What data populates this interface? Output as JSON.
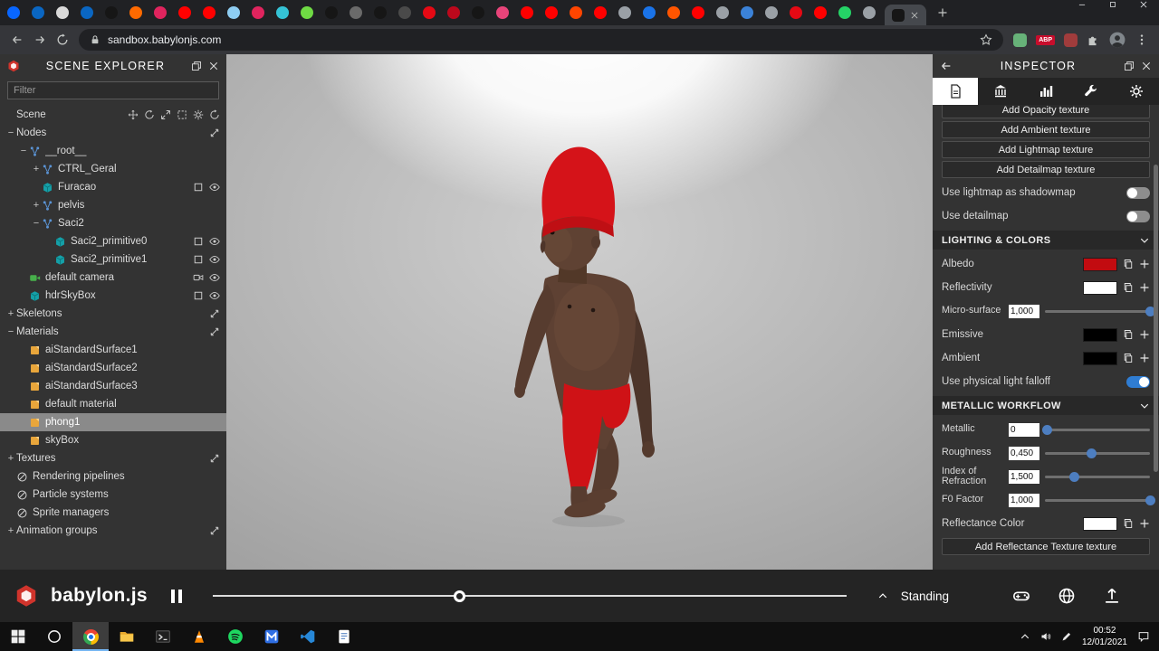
{
  "browser": {
    "tab_favicons": [
      "#0866ff",
      "#0a66c2",
      "#d9d9d9",
      "#0a66c2",
      "#161616",
      "#ff6a00",
      "#e0245e",
      "#ff0000",
      "#ff0000",
      "#8ecdf2",
      "#e0245e",
      "#35c3d6",
      "#6fda44",
      "#161616",
      "#6a6a6a",
      "#161616",
      "#4a4a4a",
      "#e50914",
      "#bd081c",
      "#161616",
      "#e8447a",
      "#ff0000",
      "#ff0000",
      "#ff4500",
      "#ff0000",
      "#9aa0a6",
      "#1a73e8",
      "#ff5500",
      "#ff0000",
      "#9aa0a6",
      "#3b82d8",
      "#9aa0a6",
      "#e50914",
      "#ff0000",
      "#25d366",
      "#9aa0a6"
    ],
    "active_tab_color": "#161616",
    "url": "sandbox.babylonjs.com",
    "extensions": [
      {
        "name": "adguard-extension-icon",
        "color": "#67b279"
      },
      {
        "name": "adblock-plus-extension-icon",
        "color": "#c70d2c",
        "label": "ABP"
      },
      {
        "name": "onetab-extension-icon",
        "color": "#a03c3c"
      },
      {
        "name": "extensions-puzzle-icon",
        "color": "#c4c7c5"
      }
    ]
  },
  "explorer": {
    "title": "SCENE EXPLORER",
    "filter_placeholder": "Filter",
    "items": [
      {
        "label": "Scene",
        "level": 0,
        "right": [
          "move-gizmo-icon",
          "rotate-gizmo-icon",
          "scale-gizmo-icon",
          "bbox-gizmo-icon",
          "gear-icon",
          "refresh-icon"
        ]
      },
      {
        "label": "Nodes",
        "level": 0,
        "exp": "−",
        "right": [
          "expand-all-icon"
        ]
      },
      {
        "label": "__root__",
        "level": 1,
        "exp": "−",
        "icon": "transform-node-icon"
      },
      {
        "label": "CTRL_Geral",
        "level": 2,
        "exp": "+",
        "icon": "transform-node-icon"
      },
      {
        "label": "Furacao",
        "level": 2,
        "icon": "mesh-icon",
        "right": [
          "checkbox-icon",
          "eye-icon"
        ]
      },
      {
        "label": "pelvis",
        "level": 2,
        "exp": "+",
        "icon": "transform-node-icon"
      },
      {
        "label": "Saci2",
        "level": 2,
        "exp": "−",
        "icon": "transform-node-icon"
      },
      {
        "label": "Saci2_primitive0",
        "level": 3,
        "icon": "mesh-icon",
        "right": [
          "checkbox-icon",
          "eye-icon"
        ]
      },
      {
        "label": "Saci2_primitive1",
        "level": 3,
        "icon": "mesh-icon",
        "right": [
          "checkbox-icon",
          "eye-icon"
        ]
      },
      {
        "label": "default camera",
        "level": 1,
        "icon": "camera-icon",
        "right": [
          "videocam-icon",
          "eye-icon"
        ]
      },
      {
        "label": "hdrSkyBox",
        "level": 1,
        "icon": "mesh-icon",
        "right": [
          "checkbox-icon",
          "eye-icon"
        ]
      },
      {
        "label": "Skeletons",
        "level": 0,
        "exp": "+",
        "right": [
          "expand-all-icon"
        ]
      },
      {
        "label": "Materials",
        "level": 0,
        "exp": "−",
        "right": [
          "expand-all-icon"
        ]
      },
      {
        "label": "aiStandardSurface1",
        "level": 1,
        "icon": "material-icon"
      },
      {
        "label": "aiStandardSurface2",
        "level": 1,
        "icon": "material-icon"
      },
      {
        "label": "aiStandardSurface3",
        "level": 1,
        "icon": "material-icon"
      },
      {
        "label": "default material",
        "level": 1,
        "icon": "material-icon"
      },
      {
        "label": "phong1",
        "level": 1,
        "icon": "material-icon",
        "selected": true
      },
      {
        "label": "skyBox",
        "level": 1,
        "icon": "material-icon"
      },
      {
        "label": "Textures",
        "level": 0,
        "exp": "+",
        "right": [
          "expand-all-icon"
        ]
      },
      {
        "label": "Rendering pipelines",
        "level": 0,
        "icon": "circle-slash-icon"
      },
      {
        "label": "Particle systems",
        "level": 0,
        "icon": "circle-slash-icon"
      },
      {
        "label": "Sprite managers",
        "level": 0,
        "icon": "circle-slash-icon"
      },
      {
        "label": "Animation groups",
        "level": 0,
        "exp": "+",
        "right": [
          "expand-all-icon"
        ]
      }
    ]
  },
  "inspector": {
    "title": "INSPECTOR",
    "tabs": [
      {
        "icon": "file-tab-icon",
        "active": true
      },
      {
        "icon": "debug-tab-icon"
      },
      {
        "icon": "stats-tab-icon"
      },
      {
        "icon": "tools-tab-icon"
      },
      {
        "icon": "settings-tab-icon"
      }
    ],
    "content": [
      {
        "type": "button",
        "label": "Add Opacity texture",
        "clipped": true
      },
      {
        "type": "button",
        "label": "Add Ambient texture"
      },
      {
        "type": "button",
        "label": "Add Lightmap texture"
      },
      {
        "type": "button",
        "label": "Add Detailmap texture"
      },
      {
        "type": "toggle",
        "label": "Use lightmap as shadowmap",
        "on": false
      },
      {
        "type": "toggle",
        "label": "Use detailmap",
        "on": false
      },
      {
        "type": "section",
        "label": "LIGHTING & COLORS"
      },
      {
        "type": "color",
        "label": "Albedo",
        "color": "#c20b10"
      },
      {
        "type": "color",
        "label": "Reflectivity",
        "color": "#ffffff"
      },
      {
        "type": "slider",
        "label": "Micro-surface",
        "value": "1,000",
        "pct": 100
      },
      {
        "type": "color",
        "label": "Emissive",
        "color": "#000000"
      },
      {
        "type": "color",
        "label": "Ambient",
        "color": "#000000"
      },
      {
        "type": "toggle",
        "label": "Use physical light falloff",
        "on": true
      },
      {
        "type": "section",
        "label": "METALLIC WORKFLOW"
      },
      {
        "type": "slider",
        "label": "Metallic",
        "value": "0",
        "pct": 2
      },
      {
        "type": "slider",
        "label": "Roughness",
        "value": "0,450",
        "pct": 44
      },
      {
        "type": "slider",
        "label": "Index of Refraction",
        "value": "1,500",
        "pct": 28
      },
      {
        "type": "slider",
        "label": "F0 Factor",
        "value": "1,000",
        "pct": 100
      },
      {
        "type": "color",
        "label": "Reflectance Color",
        "color": "#ffffff"
      },
      {
        "type": "button",
        "label": "Add Reflectance Texture texture"
      }
    ]
  },
  "playbar": {
    "brand": "babylon.js",
    "animation": "Standing",
    "progress_pct": 39,
    "icons": [
      "gamepad-icon",
      "globe-icon",
      "export-icon"
    ]
  },
  "taskbar": {
    "apps": [
      {
        "icon": "windows-start-icon"
      },
      {
        "icon": "cortana-icon"
      },
      {
        "icon": "chrome-icon",
        "active": true
      },
      {
        "icon": "folder-icon"
      },
      {
        "icon": "terminal-icon"
      },
      {
        "icon": "vlc-icon"
      },
      {
        "icon": "spotify-icon"
      },
      {
        "icon": "m-app-icon"
      },
      {
        "icon": "vscode-icon"
      },
      {
        "icon": "notes-icon"
      }
    ],
    "tray_icons": [
      "chevron-up-icon",
      "volume-icon",
      "pen-icon"
    ],
    "time": "00:52",
    "date": "12/01/2021"
  }
}
